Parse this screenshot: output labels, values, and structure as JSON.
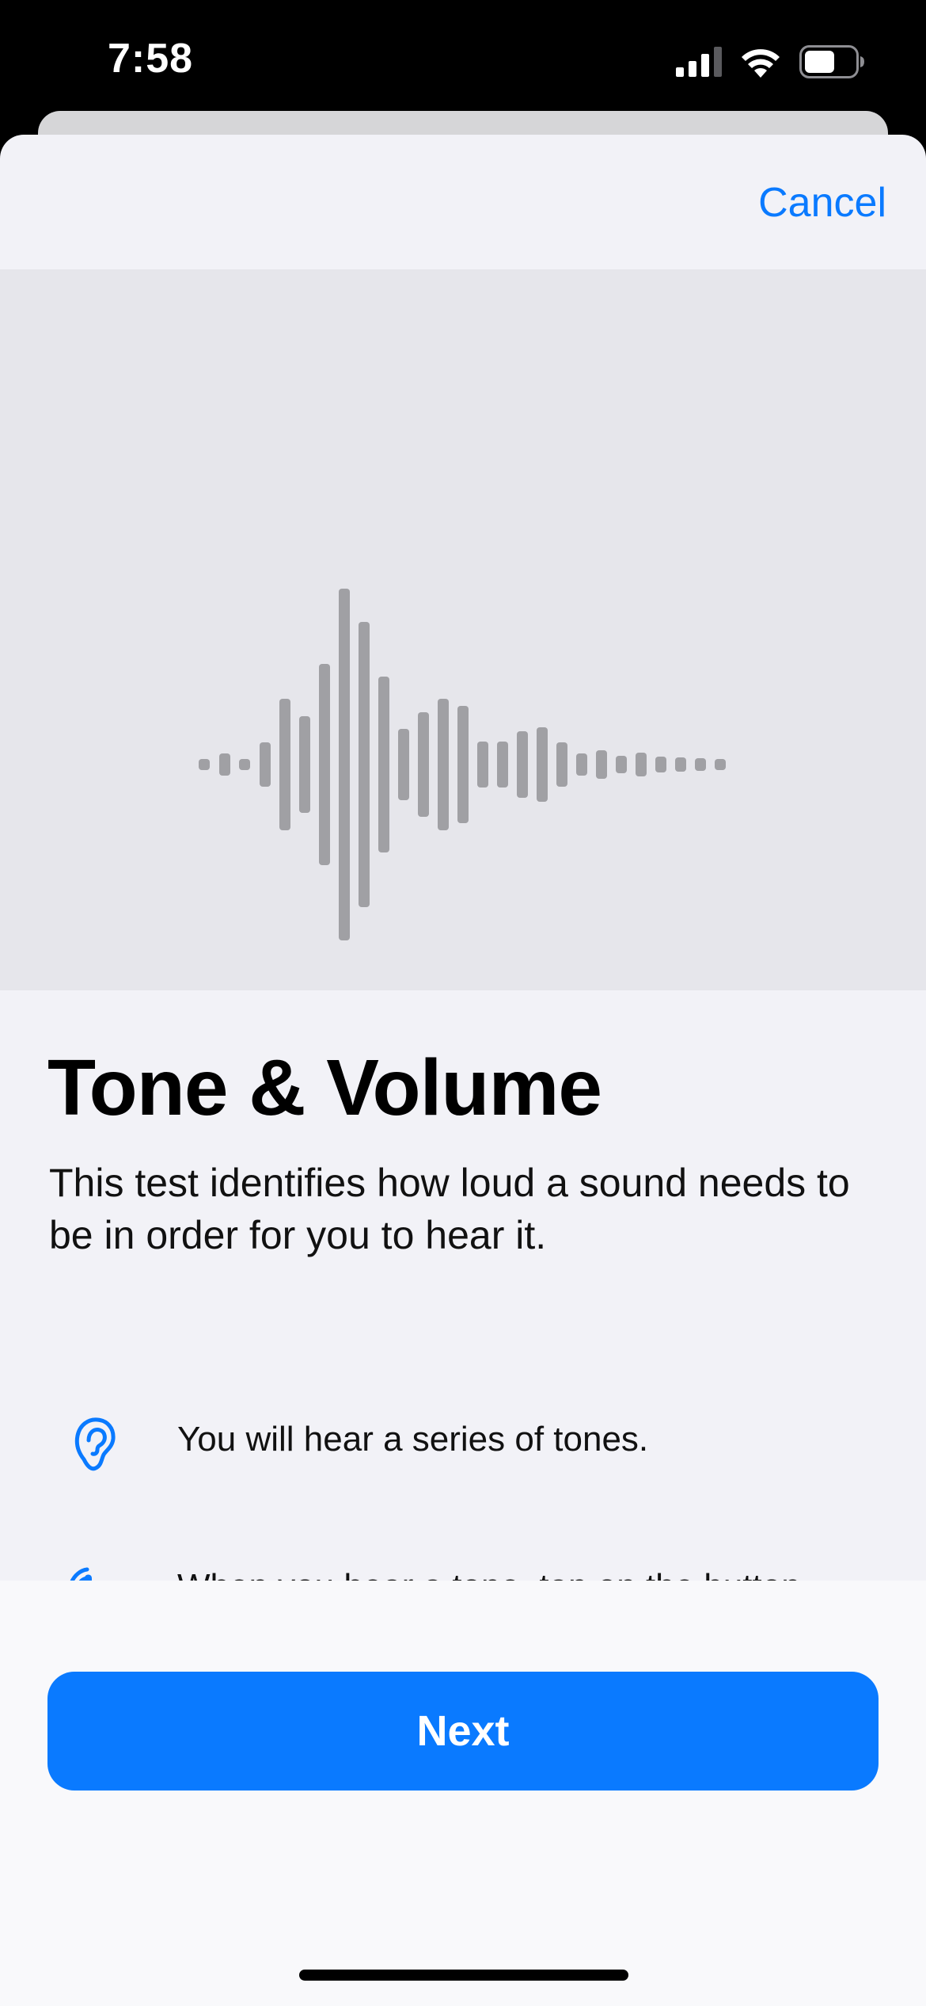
{
  "status_bar": {
    "time": "7:58",
    "signal_icon": "cellular-signal-icon",
    "wifi_icon": "wifi-icon",
    "battery_icon": "battery-icon",
    "battery_level": 0.6
  },
  "nav": {
    "cancel_label": "Cancel"
  },
  "hero": {
    "icon": "waveform-icon"
  },
  "main": {
    "title": "Tone & Volume",
    "description": "This test identifies how loud a sound needs to be in order for you to hear it.",
    "items": [
      {
        "icon": "ear-icon",
        "text": "You will hear a series of tones."
      },
      {
        "icon": "tap-hand-icon",
        "text": "When you hear a tone, tap on the button."
      }
    ]
  },
  "footer": {
    "next_label": "Next"
  },
  "colors": {
    "accent": "#0A7AFF",
    "waveform": "#A0A0A4",
    "sheet_background": "#F2F2F7",
    "hero_background": "#E6E6EB"
  }
}
